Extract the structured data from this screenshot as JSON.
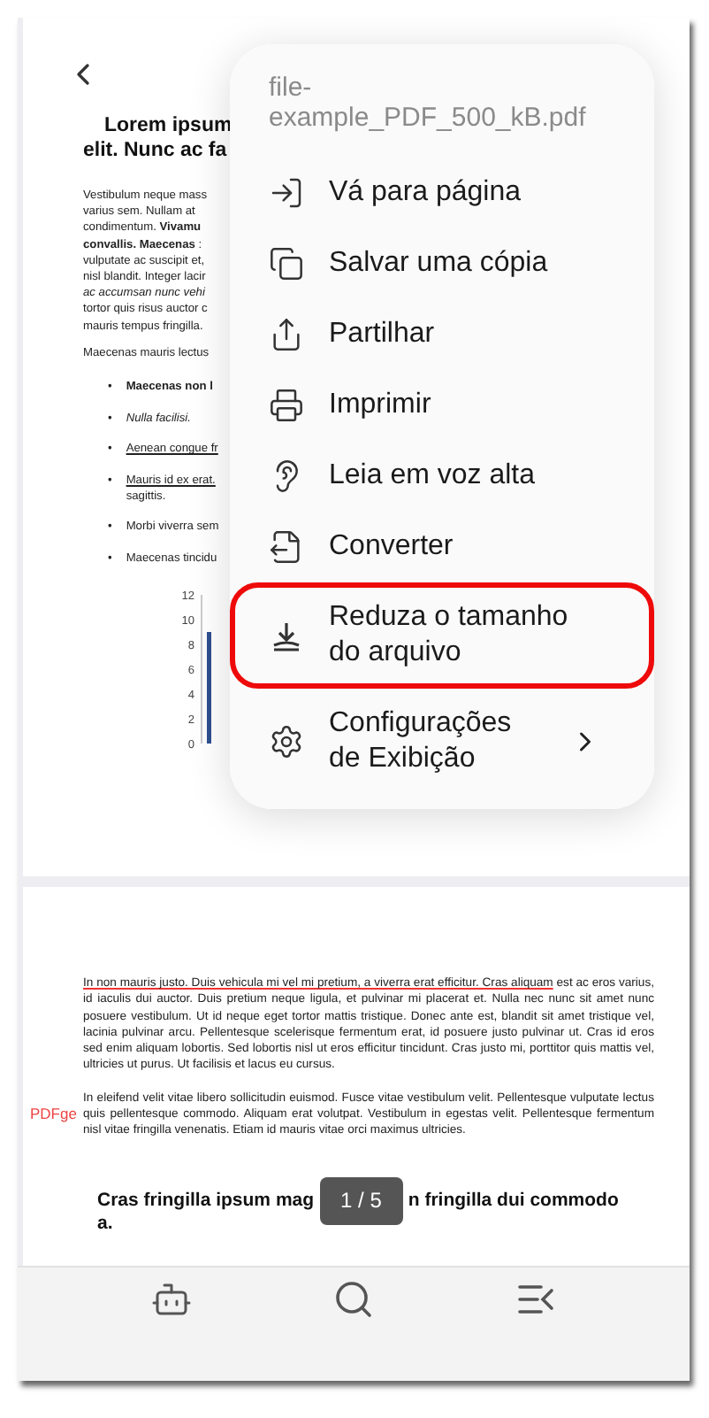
{
  "page_1": {
    "heading": [
      "Lorem ipsum",
      "elit. Nunc ac fa"
    ],
    "paragraph": "Vestibulum neque mass\nvarius sem. Nullam at\ncondimentum. **Vivamu**\n**convallis. Maecenas** :\nvulputate ac suscipit et,\nnisl blandit. Integer lacir\n*ac accumsan nunc vehi*\ntortor quis risus auctor c\nmauris tempus fringilla.",
    "intro": "Maecenas mauris lectus",
    "bullets": [
      {
        "marker": "•",
        "text": "Maecenas non l",
        "kind": "bold"
      },
      {
        "marker": "•",
        "text": "Nulla facilisi.",
        "kind": "italic"
      },
      {
        "marker": "•",
        "text": "Aenean congue fr",
        "kind": "link"
      },
      {
        "marker": "•",
        "text": "Mauris id ex erat.",
        "kind": "link",
        "extra": "sagittis."
      },
      {
        "marker": "•",
        "text": "Morbi viverra sem",
        "kind": "plain"
      },
      {
        "marker": "•",
        "text": "Maecenas tincidu",
        "kind": "plain"
      }
    ],
    "chart_data": {
      "type": "bar",
      "ylim": [
        0,
        12
      ],
      "yticks": [
        0,
        2,
        4,
        6,
        8,
        10,
        12
      ],
      "series": [
        {
          "color": "#2f4f8f",
          "values": [
            9
          ]
        }
      ]
    }
  },
  "page_2": {
    "paragraphs": [
      {
        "marked": "In non mauris justo. Duis vehicula mi vel mi pretium, a viverra erat efficitur. Cras aliquam",
        "text": " est ac eros varius, id iaculis dui auctor. Duis pretium neque ligula, et pulvinar mi placerat et. Nulla nec nunc sit amet nunc posuere vestibulum. Ut id neque eget tortor mattis tristique. Donec ante est, blandit sit amet tristique vel, lacinia pulvinar arcu. Pellentesque scelerisque fermentum erat, id posuere justo pulvinar ut. Cras id eros sed enim aliquam lobortis. Sed lobortis nisl ut eros efficitur tincidunt. Cras justo mi, porttitor quis mattis vel, ultricies ut purus. Ut facilisis et lacus eu cursus."
      },
      {
        "text": "In eleifend velit vitae libero sollicitudin euismod. Fusce vitae vestibulum velit. Pellentesque vulputate lectus quis pellentesque commodo. Aliquam erat volutpat. Vestibulum in egestas velit. Pellentesque fermentum nisl vitae fringilla venenatis. Etiam id mauris vitae orci maximus ultricies."
      }
    ],
    "stamp": "PDFge",
    "heading_parts": [
      "Cras fringilla ipsum mag",
      "n fringilla dui commodo",
      "a."
    ]
  },
  "page_indicator": "1 / 5",
  "menu": {
    "title": "file-example_PDF_500_kB.pdf",
    "items": [
      {
        "kind": "goto",
        "label": "Vá para página",
        "highlighted": false,
        "submenu": false
      },
      {
        "kind": "copy",
        "label": "Salvar uma cópia",
        "highlighted": false,
        "submenu": false
      },
      {
        "kind": "share",
        "label": "Partilhar",
        "highlighted": false,
        "submenu": false
      },
      {
        "kind": "print",
        "label": "Imprimir",
        "highlighted": false,
        "submenu": false
      },
      {
        "kind": "read",
        "label": "Leia em voz alta",
        "highlighted": false,
        "submenu": false
      },
      {
        "kind": "convert",
        "label": "Converter",
        "highlighted": false,
        "submenu": false
      },
      {
        "kind": "reduce",
        "label": "Reduza o tamanho do arquivo",
        "highlighted": true,
        "submenu": false
      },
      {
        "kind": "settings",
        "label": "Configurações de Exibição",
        "highlighted": false,
        "submenu": true
      }
    ]
  },
  "bottom_bar": [
    {
      "kind": "assistant"
    },
    {
      "kind": "search"
    },
    {
      "kind": "outline"
    }
  ]
}
